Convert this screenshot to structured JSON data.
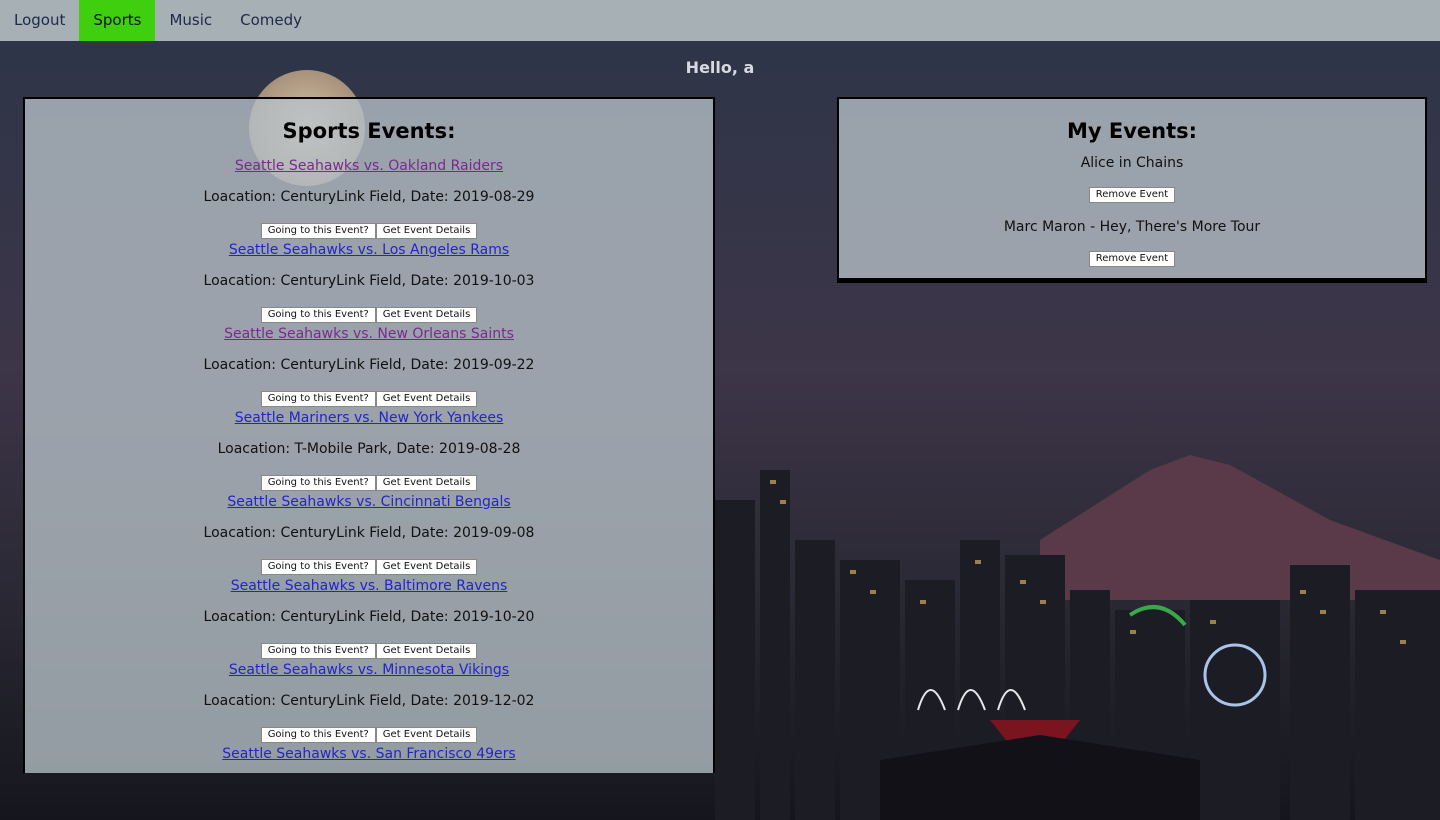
{
  "nav": {
    "items": [
      {
        "label": "Logout",
        "active": false
      },
      {
        "label": "Sports",
        "active": true
      },
      {
        "label": "Music",
        "active": false
      },
      {
        "label": "Comedy",
        "active": false
      }
    ]
  },
  "greeting": "Hello, a",
  "sports": {
    "title": "Sports Events:",
    "going_label": "Going to this Event?",
    "details_label": "Get Event Details",
    "events": [
      {
        "name": "Seattle Seahawks vs. Oakland Raiders",
        "location": "Loacation: CenturyLink Field, Date: 2019-08-29",
        "visited": true
      },
      {
        "name": "Seattle Seahawks vs. Los Angeles Rams",
        "location": "Loacation: CenturyLink Field, Date: 2019-10-03",
        "visited": false
      },
      {
        "name": "Seattle Seahawks vs. New Orleans Saints",
        "location": "Loacation: CenturyLink Field, Date: 2019-09-22",
        "visited": true
      },
      {
        "name": "Seattle Mariners vs. New York Yankees",
        "location": "Loacation: T-Mobile Park, Date: 2019-08-28",
        "visited": false
      },
      {
        "name": "Seattle Seahawks vs. Cincinnati Bengals",
        "location": "Loacation: CenturyLink Field, Date: 2019-09-08",
        "visited": false
      },
      {
        "name": "Seattle Seahawks vs. Baltimore Ravens",
        "location": "Loacation: CenturyLink Field, Date: 2019-10-20",
        "visited": false
      },
      {
        "name": "Seattle Seahawks vs. Minnesota Vikings",
        "location": "Loacation: CenturyLink Field, Date: 2019-12-02",
        "visited": false
      },
      {
        "name": "Seattle Seahawks vs. San Francisco 49ers",
        "location": "",
        "visited": false
      }
    ]
  },
  "my_events": {
    "title": "My Events:",
    "remove_label": "Remove Event",
    "events": [
      {
        "name": "Alice in Chains"
      },
      {
        "name": "Marc Maron - Hey, There's More Tour"
      }
    ]
  },
  "colors": {
    "nav_bg": "#a7b0b5",
    "nav_active": "#3fcf0f",
    "link": "#2424c8",
    "link_visited": "#7a2a8e"
  }
}
